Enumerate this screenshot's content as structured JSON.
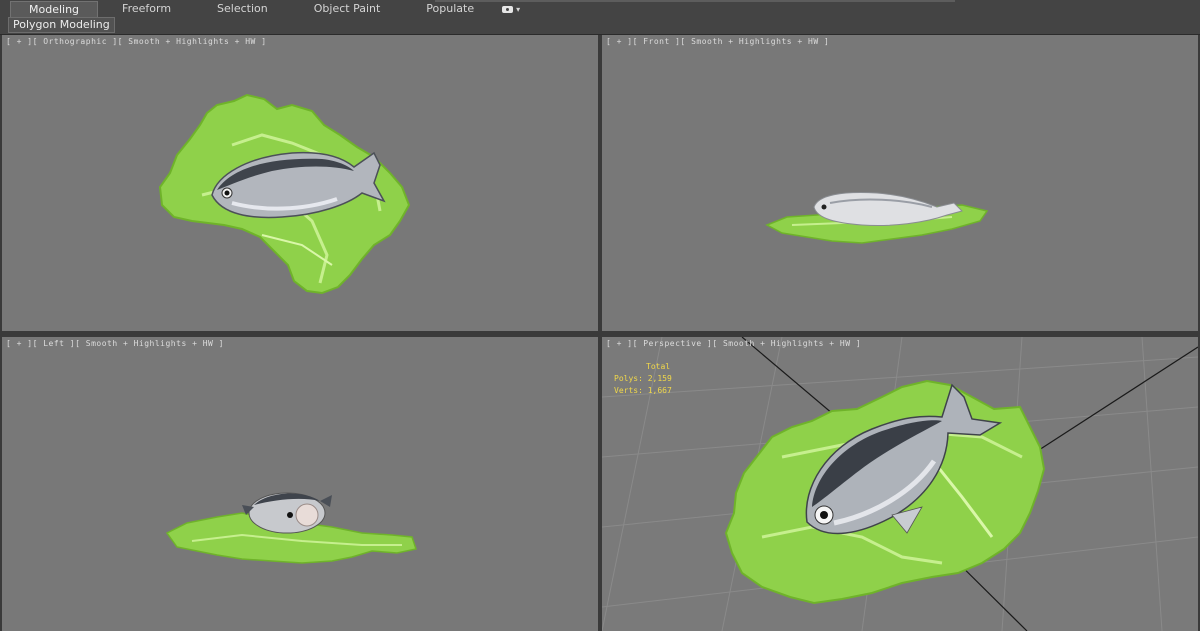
{
  "ribbon": {
    "tabs": [
      {
        "label": "Modeling",
        "active": true
      },
      {
        "label": "Freeform",
        "active": false
      },
      {
        "label": "Selection",
        "active": false
      },
      {
        "label": "Object Paint",
        "active": false
      },
      {
        "label": "Populate",
        "active": false
      }
    ],
    "subtab": "Polygon Modeling"
  },
  "viewports": {
    "top_left": {
      "label": "[ + ][ Orthographic ][ Smooth + Highlights + HW ]"
    },
    "top_right": {
      "label": "[ + ][ Front ][ Smooth + Highlights + HW ]"
    },
    "bottom_left": {
      "label": "[ + ][ Left ][ Smooth + Highlights + HW ]"
    },
    "bottom_right": {
      "label": "[ + ][ Perspective ][ Smooth + Highlights + HW ]",
      "stats": {
        "title": "Total",
        "polys": "Polys: 2,159",
        "verts": "Verts: 1,667"
      }
    }
  },
  "colors": {
    "viewport_bg": "#787878",
    "stats_text": "#f1d84a",
    "lettuce": "#8fd14a",
    "fish_body": "#b4b8c0"
  }
}
